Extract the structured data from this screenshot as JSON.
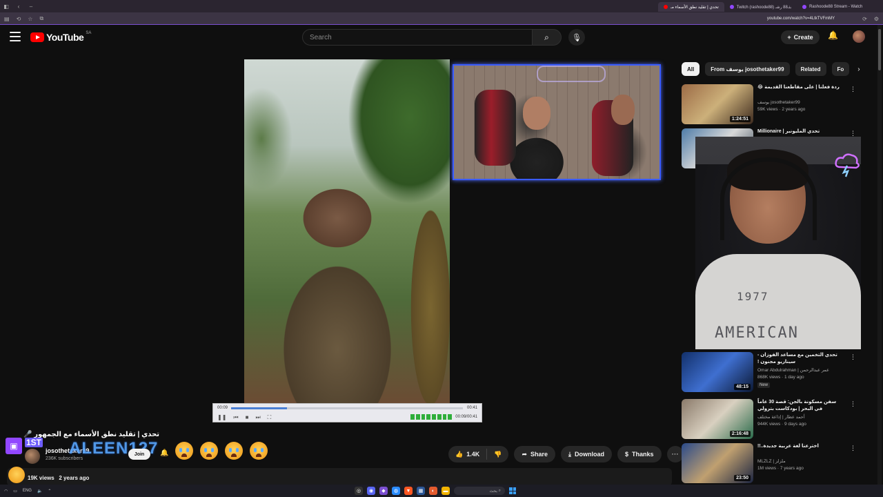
{
  "browser": {
    "tabs": [
      {
        "label": "تحدي | تقليد نطق الأسماء مـ",
        "active": true,
        "dot_color": "#ff0000"
      },
      {
        "label": "Twitch (rashoode88) بثـ88 رشـ",
        "active": false,
        "dot_color": "#9147ff"
      },
      {
        "label": "Rashoode88 Stream - Watch",
        "active": false,
        "dot_color": "#9147ff"
      }
    ],
    "url": "youtube.com/watch?v=4LtkTVFmMY"
  },
  "header": {
    "brand": "YouTube",
    "country_code": "SA",
    "search_placeholder": "Search",
    "create_label": "Create"
  },
  "player": {
    "time_current": "00:09",
    "time_total": "00:41",
    "time_display": "00:09/00:41",
    "progress": 0.24
  },
  "video": {
    "title": "تحدي | تقليد نطق الأسماء مع الجمهور 🎤",
    "channel_name": "josothetaker99",
    "subscribers": "236K subscribers",
    "join_label": "Join",
    "likes": "1.4K",
    "share_label": "Share",
    "download_label": "Download",
    "thanks_label": "Thanks",
    "views": "19K views",
    "posted": "2 years ago"
  },
  "overlay": {
    "twitch_badge": "1ST",
    "chat_user": "ALEEN127"
  },
  "stream": {
    "shirt_line1": "1977",
    "shirt_line2": "AMERICAN"
  },
  "sidebar": {
    "chips": [
      {
        "label": "All",
        "active": true
      },
      {
        "label": "From يوسف josothetaker99",
        "active": false
      },
      {
        "label": "Related",
        "active": false
      },
      {
        "label": "Fo",
        "active": false
      }
    ],
    "recs": [
      {
        "title": "ردة فعلنا | على مقاطعنا القديمة 😂",
        "channel": "يوسف josothetaker99",
        "meta": "59K views · 2 years ago",
        "duration": "1:24:51",
        "badge": ""
      },
      {
        "title": "تحدي المليونير | Millionaire",
        "channel": "",
        "meta": "",
        "duration": "",
        "badge": ""
      },
      {
        "title": "تحدي التخمين مع مساعد الفوزان - سيناريو مجنون !",
        "channel": "Omar Abdulrahman | عمر عبدالرحمن",
        "meta": "868K views · 1 day ago",
        "duration": "48:15",
        "badge": "New"
      },
      {
        "title": "سفن مسكونة بالجن: قصة 30 عاماً في البحر | بودكاست بترولي",
        "channel": "أحمد عطار | إذاعة مختلف",
        "meta": "944K views · 9 days ago",
        "duration": "2:16:48",
        "badge": ""
      },
      {
        "title": "اخترعنا لغة عربية جديدة..!!",
        "channel": "MLZLZ | ملزلز",
        "meta": "1M views · 7 years ago",
        "duration": "23:50",
        "badge": ""
      }
    ]
  },
  "taskbar": {
    "search_placeholder": "بحث",
    "lang": "ENG"
  },
  "colors": {
    "accent": "#ff0000",
    "twitch": "#9147ff",
    "progress": "#4a7fd4"
  }
}
